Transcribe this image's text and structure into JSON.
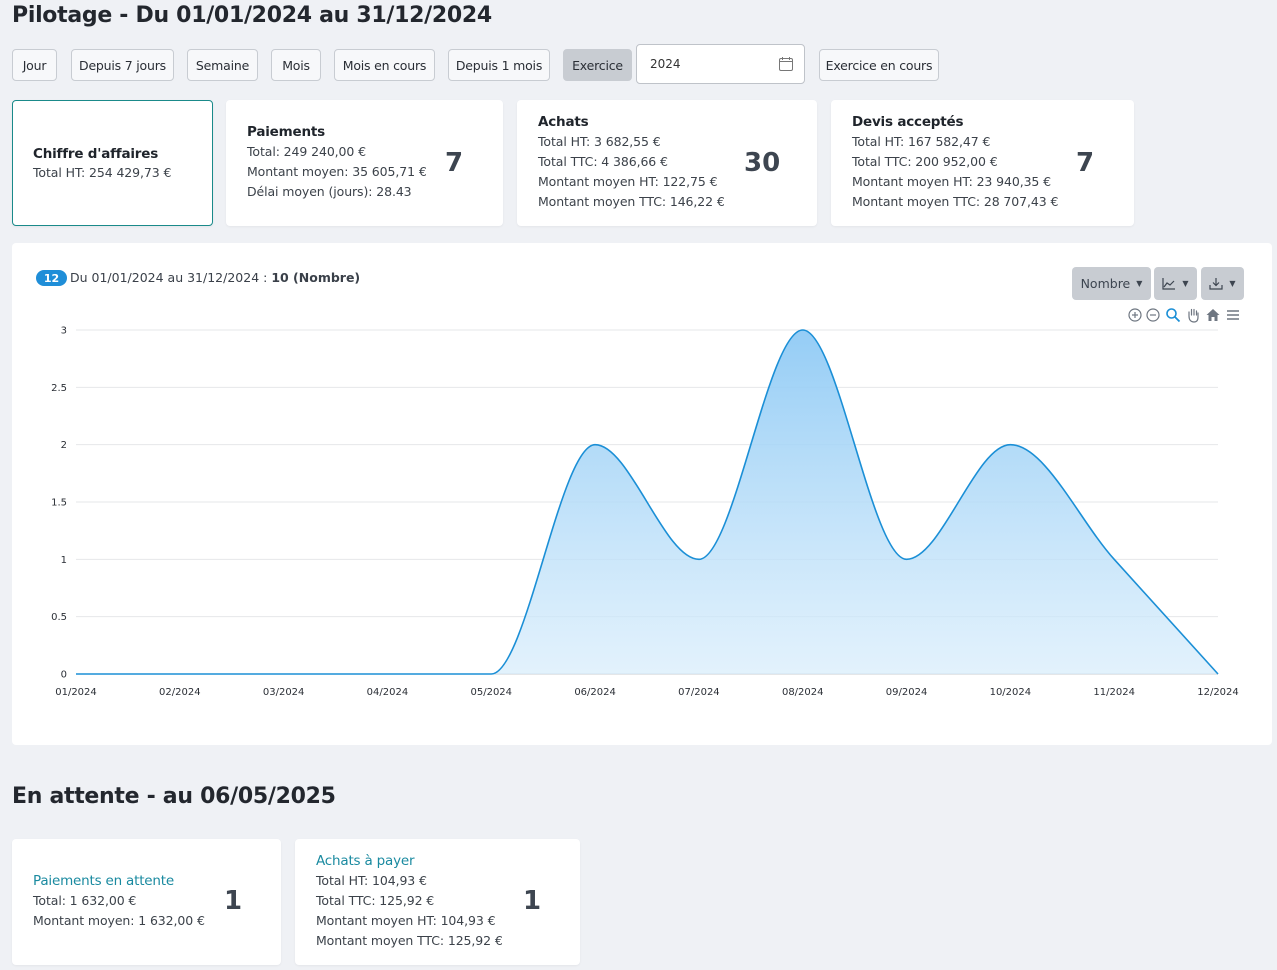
{
  "page": {
    "title": "Pilotage - Du 01/01/2024 au 31/12/2024",
    "pending_title": "En attente - au 06/05/2025"
  },
  "filters": {
    "jour": "Jour",
    "depuis7": "Depuis 7 jours",
    "semaine": "Semaine",
    "mois": "Mois",
    "mois_en_cours": "Mois en cours",
    "depuis1mois": "Depuis 1 mois",
    "exercice": "Exercice",
    "year_value": "2024",
    "exercice_en_cours": "Exercice en cours"
  },
  "kpis": {
    "ca": {
      "title": "Chiffre d'affaires",
      "l1": "Total HT: 254 429,73 €"
    },
    "paiements": {
      "title": "Paiements",
      "l1": "Total: 249 240,00 €",
      "l2": "Montant moyen: 35 605,71 €",
      "l3": "Délai moyen (jours): 28.43",
      "count": "7"
    },
    "achats": {
      "title": "Achats",
      "l1": "Total HT: 3 682,55 €",
      "l2": "Total TTC: 4 386,66 €",
      "l3": "Montant moyen HT: 122,75 €",
      "l4": "Montant moyen TTC: 146,22 €",
      "count": "30"
    },
    "devis": {
      "title": "Devis acceptés",
      "l1": "Total HT: 167 582,47 €",
      "l2": "Total TTC: 200 952,00 €",
      "l3": "Montant moyen HT: 23 940,35 €",
      "l4": "Montant moyen TTC: 28 707,43 €",
      "count": "7"
    }
  },
  "chart_panel": {
    "badge": "12",
    "caption": "Du 01/01/2024 au 31/12/2024 : ",
    "caption_bold": "10 (Nombre)",
    "metric_button": "Nombre",
    "tool_icons": [
      "zoom-in-icon",
      "zoom-out-icon",
      "zoom-select-icon",
      "pan-hand-icon",
      "home-reset-icon",
      "menu-icon"
    ]
  },
  "chart_data": {
    "type": "area",
    "x": [
      "01/2024",
      "02/2024",
      "03/2024",
      "04/2024",
      "05/2024",
      "06/2024",
      "07/2024",
      "08/2024",
      "09/2024",
      "10/2024",
      "11/2024",
      "12/2024"
    ],
    "series": [
      {
        "values": [
          0,
          0,
          0,
          0,
          0,
          2,
          1,
          3,
          1,
          2,
          1,
          0
        ]
      }
    ],
    "ylim": [
      0,
      3
    ],
    "yticks": [
      "0",
      "0.5",
      "1",
      "1.5",
      "2",
      "2.5",
      "3"
    ],
    "grid": true,
    "color": "#1b8fd6"
  },
  "pending": {
    "paiements": {
      "title": "Paiements en attente",
      "l1": "Total: 1 632,00 €",
      "l2": "Montant moyen: 1 632,00 €",
      "count": "1"
    },
    "achats": {
      "title": "Achats à payer",
      "l1": "Total HT: 104,93 €",
      "l2": "Total TTC: 125,92 €",
      "l3": "Montant moyen HT: 104,93 €",
      "l4": "Montant moyen TTC: 125,92 €",
      "count": "1"
    }
  }
}
